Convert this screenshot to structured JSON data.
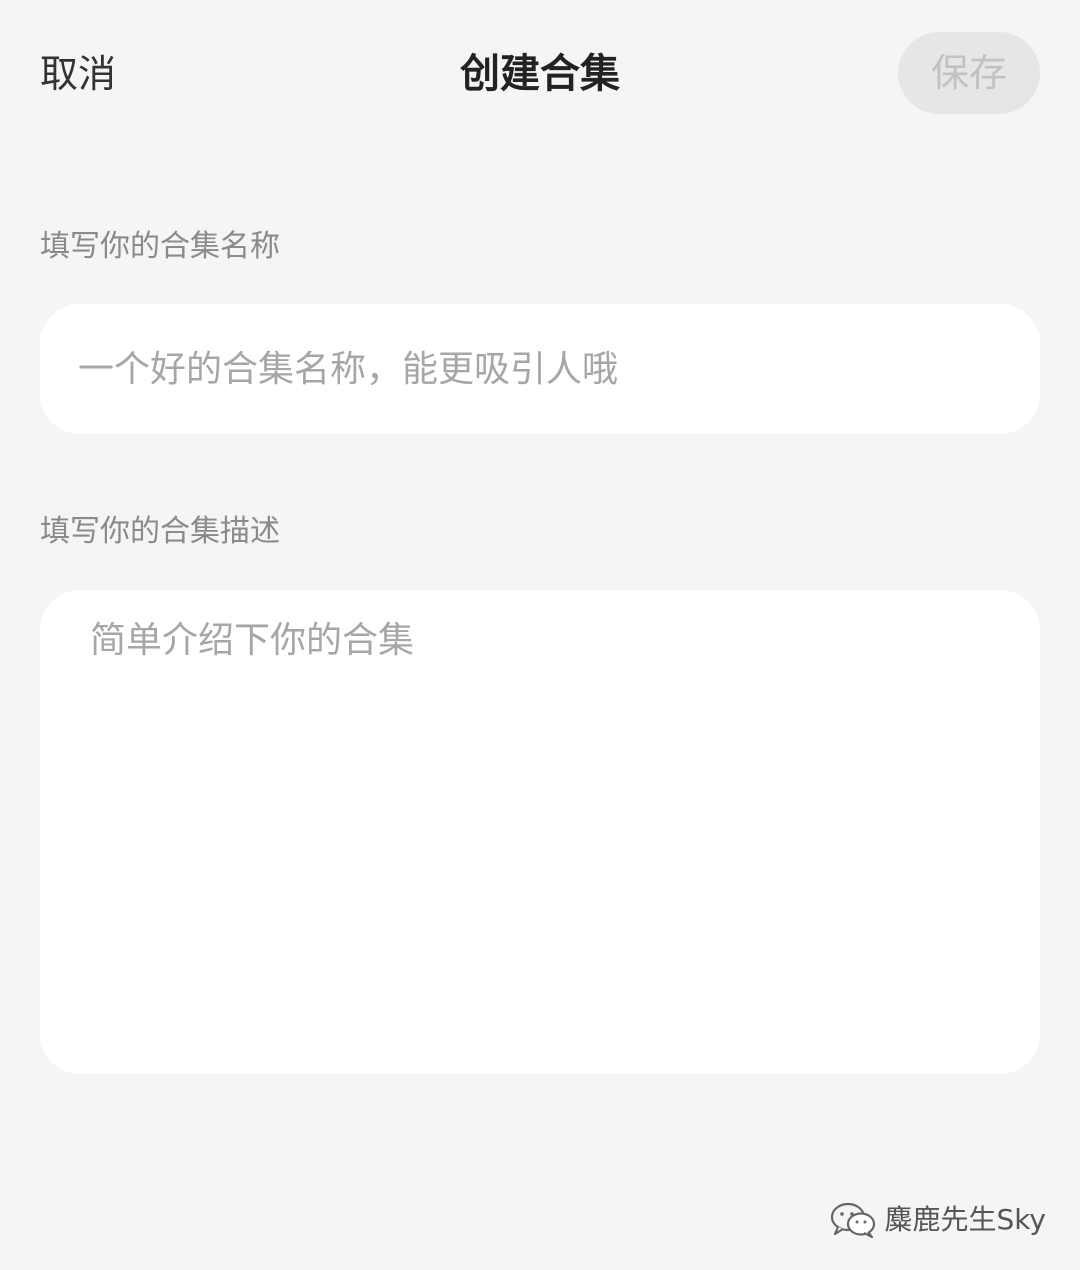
{
  "header": {
    "cancel_label": "取消",
    "title": "创建合集",
    "save_label": "保存"
  },
  "form": {
    "name_label": "填写你的合集名称",
    "name_placeholder": "一个好的合集名称，能更吸引人哦",
    "name_value": "",
    "desc_label": "填写你的合集描述",
    "desc_placeholder": "简单介绍下你的合集",
    "desc_value": ""
  },
  "watermark": {
    "icon": "wechat-official-account-icon",
    "text": "麋鹿先生Sky"
  },
  "colors": {
    "background": "#f5f5f5",
    "card": "#ffffff",
    "save_button_bg": "#e6e6e6",
    "save_button_text": "#c2c2c2",
    "placeholder": "#a6a6a6"
  }
}
